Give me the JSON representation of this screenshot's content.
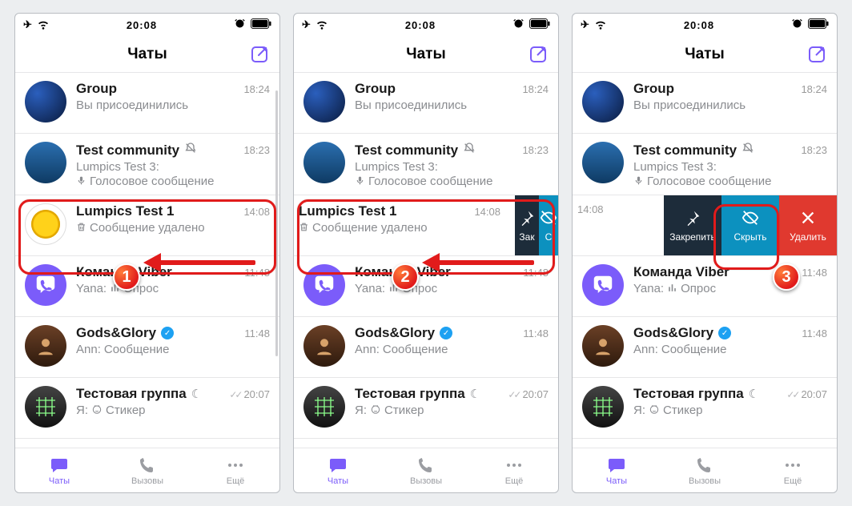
{
  "status": {
    "time": "20:08"
  },
  "nav": {
    "title": "Чаты"
  },
  "actions": {
    "pin": "Закрепить",
    "hide": "Скрыть",
    "delete": "Удалить",
    "pin_short": "Зак",
    "hide_short": "С"
  },
  "tabs": {
    "chats": "Чаты",
    "calls": "Вызовы",
    "more": "Ещё"
  },
  "step_badges": [
    "1",
    "2",
    "3"
  ],
  "chats": [
    {
      "title": "Group",
      "time": "18:24",
      "sub": "Вы присоединились",
      "avatar": "globe"
    },
    {
      "title": "Test community",
      "time": "18:23",
      "muted": true,
      "sub": "Lumpics Test 3:",
      "sub2_icon": "mic",
      "sub2": "Голосовое сообщение",
      "avatar": "cloud"
    },
    {
      "title": "Lumpics Test 1",
      "time": "14:08",
      "sub_icon": "trash",
      "sub": "Сообщение удалено",
      "avatar": "lemon",
      "highlight": true
    },
    {
      "title": "Команда Viber",
      "time": "11:48",
      "sub_prefix": "Yana: ",
      "sub_icon": "bars",
      "sub": "Опрос",
      "avatar": "viber"
    },
    {
      "title": "Gods&Glory",
      "time": "11:48",
      "verified": true,
      "sub_prefix": "Ann: ",
      "sub": "Сообщение",
      "avatar": "warrior"
    },
    {
      "title": "Тестовая группа",
      "time": "20:07",
      "moon": true,
      "checks": true,
      "sub_prefix": "Я: ",
      "sub_icon": "cat",
      "sub": "Стикер",
      "avatar": "circuit"
    }
  ]
}
